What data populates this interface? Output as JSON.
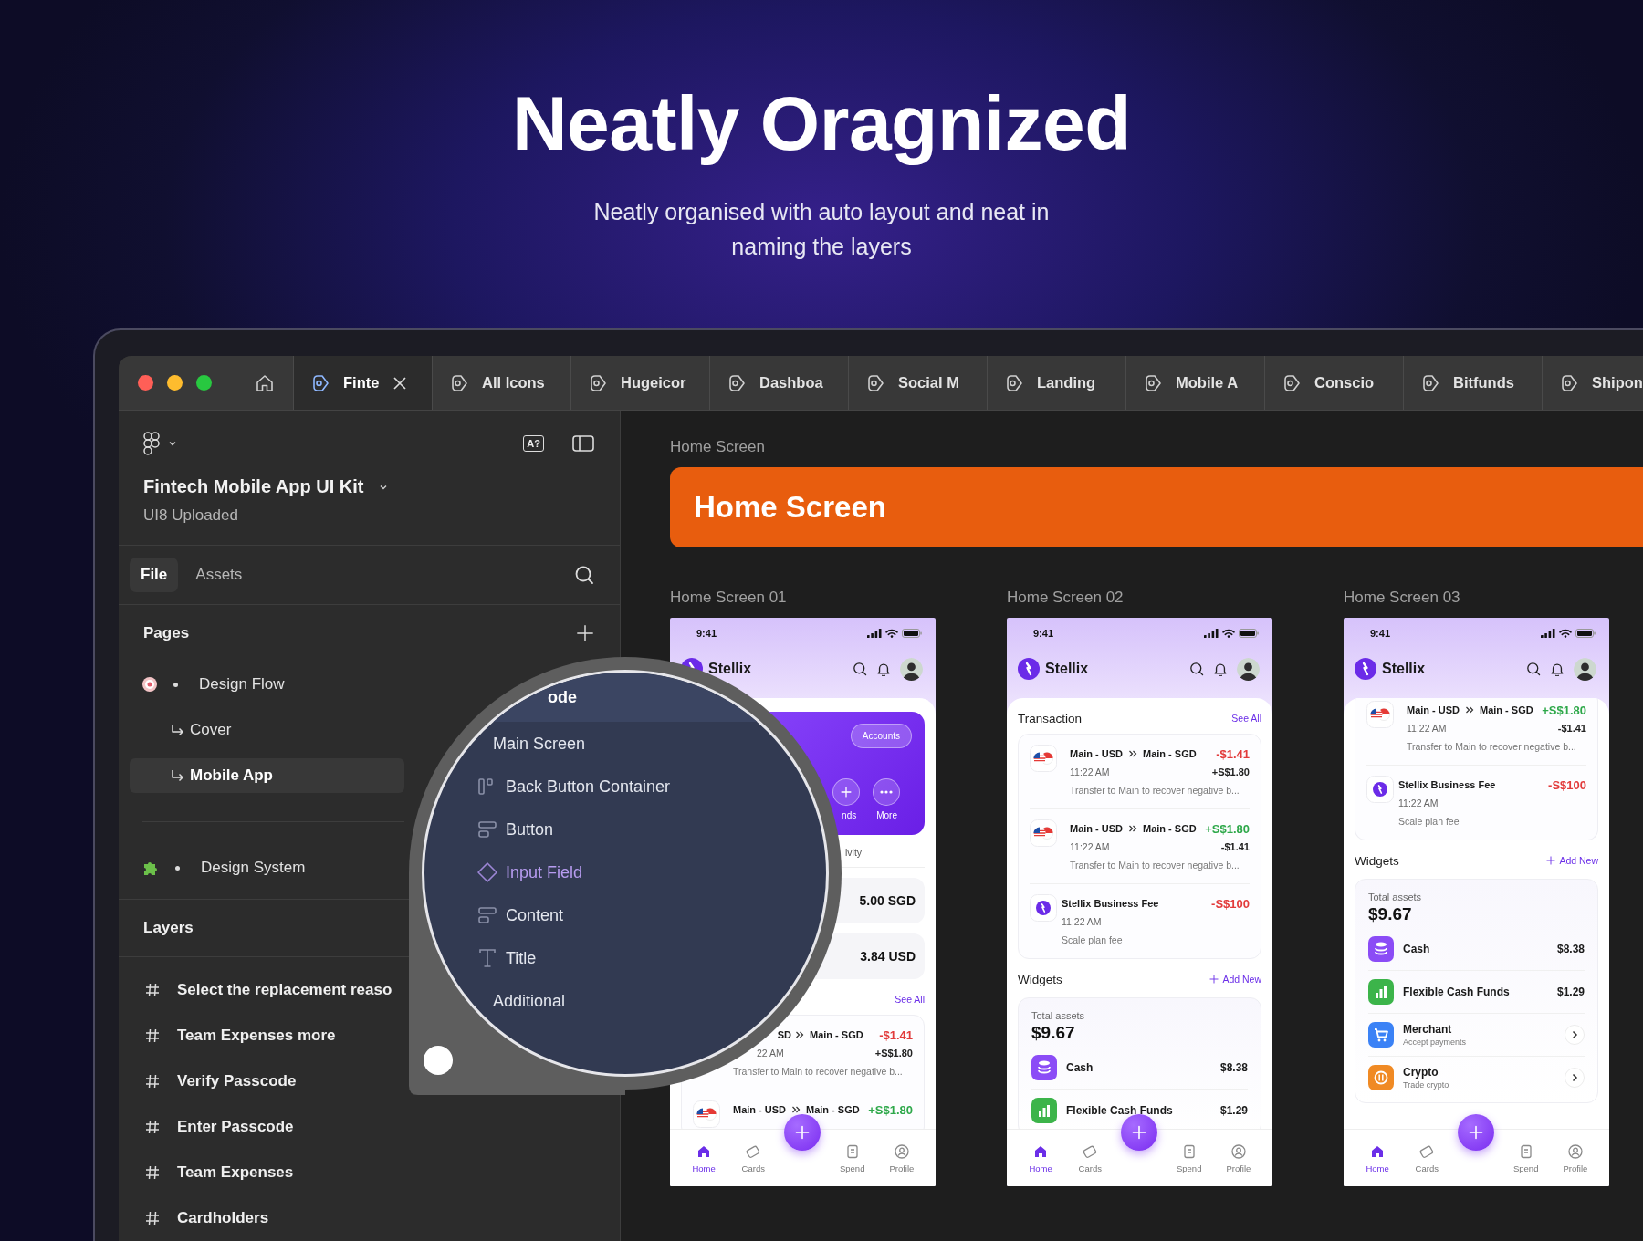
{
  "hero": {
    "title": "Neatly Oragnized",
    "subtitle": "Neatly organised with auto layout and neat in naming the layers"
  },
  "tabs": [
    {
      "label": "Finte",
      "selected": true
    },
    {
      "label": "All Icons",
      "selected": false
    },
    {
      "label": "Hugeicor",
      "selected": false
    },
    {
      "label": "Dashboa",
      "selected": false
    },
    {
      "label": "Social M",
      "selected": false
    },
    {
      "label": "Landing",
      "selected": false
    },
    {
      "label": "Mobile A",
      "selected": false
    },
    {
      "label": "Conscio",
      "selected": false
    },
    {
      "label": "Bitfunds",
      "selected": false
    },
    {
      "label": "Shipon",
      "selected": false
    }
  ],
  "sidebar": {
    "assist_button": "A?",
    "file_name": "Fintech Mobile App UI Kit",
    "file_subtitle": "UI8 Uploaded",
    "panel_tabs": [
      {
        "label": "File",
        "selected": true
      },
      {
        "label": "Assets",
        "selected": false
      }
    ],
    "pages_title": "Pages",
    "pages": [
      {
        "label": "Design Flow",
        "selected": false,
        "children": [
          {
            "label": "Cover",
            "selected": false
          },
          {
            "label": "Mobile App",
            "selected": true
          }
        ]
      },
      {
        "label": "Design System",
        "selected": false
      }
    ],
    "layers_title": "Layers",
    "layers": [
      {
        "label": "Select the replacement reaso"
      },
      {
        "label": "Team Expenses more"
      },
      {
        "label": "Verify Passcode"
      },
      {
        "label": "Enter Passcode"
      },
      {
        "label": "Team Expenses"
      },
      {
        "label": "Cardholders"
      }
    ]
  },
  "magnifier": {
    "rows": [
      {
        "label": "ode",
        "kind": "frame",
        "selected": true
      },
      {
        "label": "Main Screen",
        "kind": "section",
        "selected": false
      },
      {
        "label": "Back Button Container",
        "kind": "columns",
        "selected": false
      },
      {
        "label": "Button",
        "kind": "rows",
        "selected": false
      },
      {
        "label": "Input Field",
        "kind": "component",
        "selected": false
      },
      {
        "label": "Content",
        "kind": "rows",
        "selected": false
      },
      {
        "label": "Title",
        "kind": "text",
        "selected": false
      },
      {
        "label": "Additional",
        "kind": "section",
        "selected": false
      }
    ]
  },
  "canvas": {
    "page_label": "Home Screen",
    "banner": "Home Screen",
    "frames": [
      {
        "label": "Home Screen 01",
        "phone": {
          "time": "9:41",
          "brand": "Stellix",
          "blocks": [
            {
              "kind": "account_card",
              "pill": "Accounts",
              "actions": [
                {
                  "label": "nds"
                },
                {
                  "label": "More"
                }
              ]
            },
            {
              "kind": "fragment",
              "text": "ivity"
            },
            {
              "kind": "balance",
              "amount": "5.00 SGD"
            },
            {
              "kind": "balance",
              "amount": "3.84 USD"
            },
            {
              "kind": "header",
              "action": {
                "kind": "link",
                "label": "See All"
              }
            },
            {
              "kind": "transactions",
              "continued": false,
              "items": [
                {
                  "kind": "partial",
                  "from": "SD",
                  "to": "Main - SGD",
                  "amount": "-$1.41",
                  "color": "#e23b3b",
                  "time": "22 AM",
                  "secondary": "+S$1.80",
                  "note": "Transfer to Main to recover negative b..."
                },
                {
                  "kind": "transfer",
                  "from": "Main - USD",
                  "to": "Main - SGD",
                  "amount": "+S$1.80",
                  "color": "#2ea84a"
                }
              ]
            }
          ],
          "nav": [
            {
              "label": "Home",
              "selected": true
            },
            {
              "label": "Cards",
              "selected": false
            },
            {
              "label": "Spend",
              "selected": false
            },
            {
              "label": "Profile",
              "selected": false
            }
          ]
        }
      },
      {
        "label": "Home Screen 02",
        "phone": {
          "time": "9:41",
          "brand": "Stellix",
          "blocks": [
            {
              "kind": "header",
              "title": "Transaction",
              "action": {
                "kind": "link",
                "label": "See All"
              }
            },
            {
              "kind": "transactions",
              "continued": false,
              "items": [
                {
                  "kind": "transfer",
                  "from": "Main - USD",
                  "to": "Main - SGD",
                  "amount": "-$1.41",
                  "color": "#e23b3b",
                  "time": "11:22 AM",
                  "secondary": "+S$1.80",
                  "note": "Transfer to Main to recover negative b..."
                },
                {
                  "kind": "transfer",
                  "from": "Main - USD",
                  "to": "Main - SGD",
                  "amount": "+S$1.80",
                  "color": "#2ea84a",
                  "time": "11:22 AM",
                  "secondary": "-$1.41",
                  "note": "Transfer to Main to recover negative b..."
                },
                {
                  "kind": "fee",
                  "title": "Stellix Business Fee",
                  "amount": "-S$100",
                  "color": "#e23b3b",
                  "time": "11:22 AM",
                  "note": "Scale plan fee"
                }
              ]
            },
            {
              "kind": "header",
              "title": "Widgets",
              "action": {
                "kind": "add",
                "label": "Add New"
              }
            },
            {
              "kind": "assets",
              "label": "Total assets",
              "total": "$9.67",
              "rows": [
                {
                  "kind": "value",
                  "label": "Cash",
                  "value": "$8.38"
                },
                {
                  "kind": "value",
                  "label": "Flexible Cash Funds",
                  "value": "$1.29"
                }
              ]
            }
          ],
          "nav": [
            {
              "label": "Home",
              "selected": true
            },
            {
              "label": "Cards",
              "selected": false
            },
            {
              "label": "Spend",
              "selected": false
            },
            {
              "label": "Profile",
              "selected": false
            }
          ]
        }
      },
      {
        "label": "Home Screen 03",
        "phone": {
          "time": "9:41",
          "brand": "Stellix",
          "blocks": [
            {
              "kind": "transactions",
              "continued": true,
              "items": [
                {
                  "kind": "transfer",
                  "from": "Main - USD",
                  "to": "Main - SGD",
                  "amount": "+S$1.80",
                  "color": "#2ea84a",
                  "time": "11:22 AM",
                  "secondary": "-$1.41",
                  "note": "Transfer to Main to recover negative b..."
                },
                {
                  "kind": "fee",
                  "title": "Stellix Business Fee",
                  "amount": "-S$100",
                  "color": "#e23b3b",
                  "time": "11:22 AM",
                  "note": "Scale plan fee"
                }
              ]
            },
            {
              "kind": "header",
              "title": "Widgets",
              "action": {
                "kind": "add",
                "label": "Add New"
              }
            },
            {
              "kind": "assets",
              "label": "Total assets",
              "total": "$9.67",
              "rows": [
                {
                  "kind": "value",
                  "label": "Cash",
                  "value": "$8.38"
                },
                {
                  "kind": "value",
                  "label": "Flexible Cash Funds",
                  "value": "$1.29"
                },
                {
                  "kind": "link",
                  "label": "Merchant",
                  "sub": "Accept payments"
                },
                {
                  "kind": "link",
                  "label": "Crypto",
                  "sub": "Trade crypto"
                }
              ]
            }
          ],
          "nav": [
            {
              "label": "Home",
              "selected": true
            },
            {
              "label": "Cards",
              "selected": false
            },
            {
              "label": "Spend",
              "selected": false
            },
            {
              "label": "Profile",
              "selected": false
            }
          ]
        }
      }
    ]
  }
}
